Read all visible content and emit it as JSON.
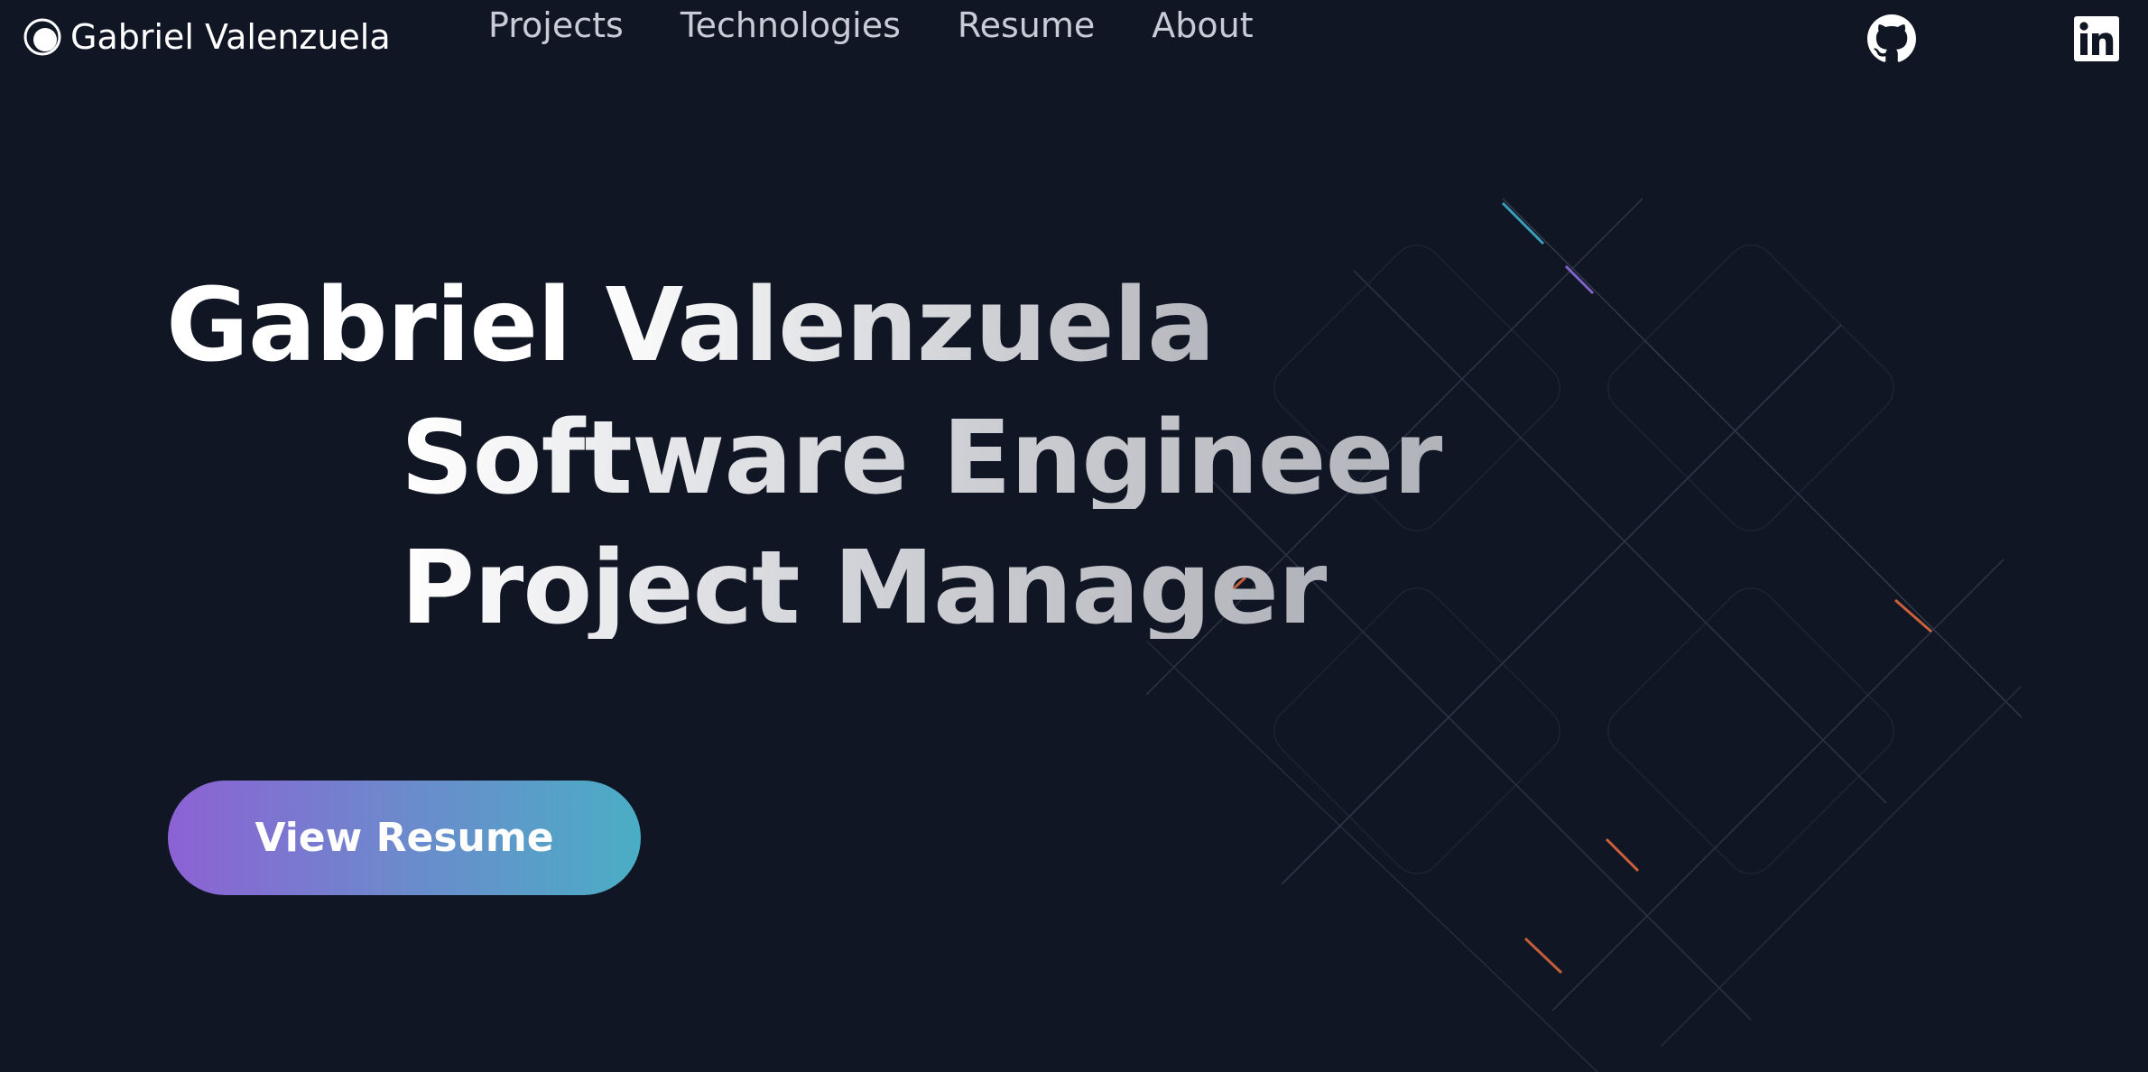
{
  "header": {
    "brand_name": "Gabriel Valenzuela",
    "nav": [
      {
        "label": "Projects"
      },
      {
        "label": "Technologies"
      },
      {
        "label": "Resume"
      },
      {
        "label": "About"
      }
    ],
    "social": [
      {
        "icon": "github-icon"
      },
      {
        "icon": "linkedin-icon"
      }
    ]
  },
  "hero": {
    "name": "Gabriel Valenzuela",
    "roles": [
      "Software Engineer",
      "Project Manager"
    ],
    "cta_label": "View Resume"
  },
  "colors": {
    "background": "#111624",
    "cta_gradient_start": "#8c62d4",
    "cta_gradient_end": "#4aaec5",
    "nav_text": "#c9ccd6"
  }
}
